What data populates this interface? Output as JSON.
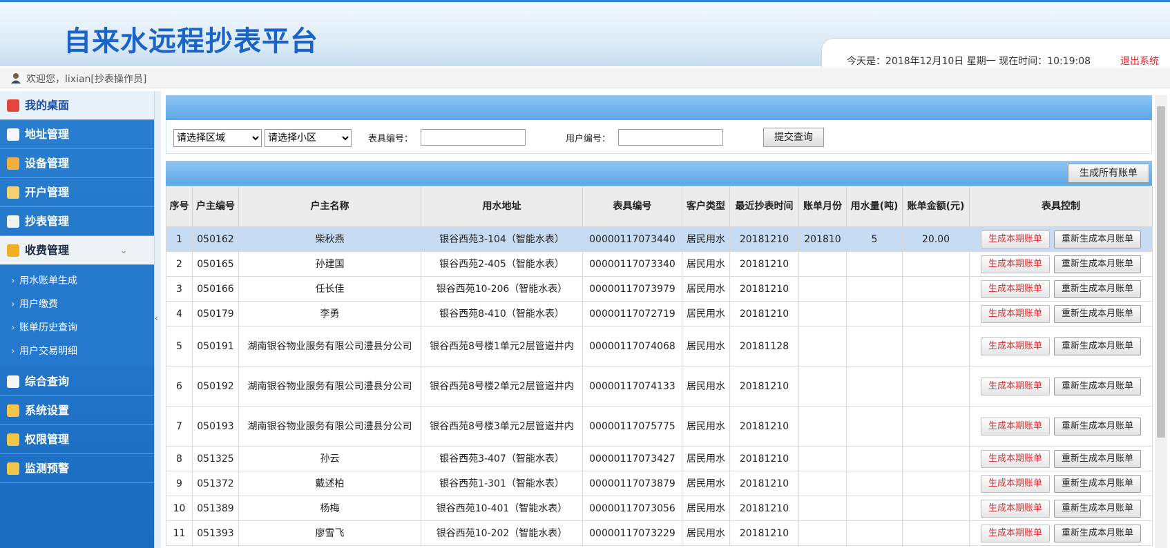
{
  "header": {
    "title": "自来水远程抄表平台",
    "date_text": "今天是：2018年12月10日 星期一 现在时间：10:19:08",
    "logout_label": "退出系统"
  },
  "welcome": "欢迎您，lixian[抄表操作员]",
  "sidebar": {
    "items": [
      {
        "label": "我的桌面",
        "icon": "home-icon"
      },
      {
        "label": "地址管理",
        "icon": "document-icon"
      },
      {
        "label": "设备管理",
        "icon": "device-icon"
      },
      {
        "label": "开户管理",
        "icon": "account-icon"
      },
      {
        "label": "抄表管理",
        "icon": "meter-read-icon"
      },
      {
        "label": "收费管理",
        "icon": "billing-icon"
      },
      {
        "label": "综合查询",
        "icon": "grid-icon"
      },
      {
        "label": "系统设置",
        "icon": "hourglass-icon"
      },
      {
        "label": "权限管理",
        "icon": "permission-icon"
      },
      {
        "label": "监测预警",
        "icon": "alert-icon"
      }
    ],
    "sub_items": [
      "用水账单生成",
      "用户缴费",
      "账单历史查询",
      "用户交易明细"
    ],
    "expand_icon": "chevron-down-icon"
  },
  "search": {
    "region_select": "请选择区域",
    "community_select": "请选择小区",
    "meter_no_label": "表具编号：",
    "meter_no_value": "",
    "user_no_label": "用户编号：",
    "user_no_value": "",
    "submit_label": "提交查询"
  },
  "generate_all_label": "生成所有账单",
  "table": {
    "headers": [
      "序号",
      "户主编号",
      "户主名称",
      "用水地址",
      "表具编号",
      "客户类型",
      "最近抄表时间",
      "账单月份",
      "用水量(吨)",
      "账单金额(元)",
      "表具控制"
    ],
    "btn_generate": "生成本期账单",
    "btn_regenerate": "重新生成本月账单",
    "rows": [
      {
        "no": "1",
        "owner_id": "050162",
        "name": "柴秋燕",
        "address": "银谷西苑3-104（智能水表）",
        "meter": "00000117073440",
        "type": "居民用水",
        "read_time": "20181210",
        "month": "201810",
        "usage": "5",
        "amount": "20.00"
      },
      {
        "no": "2",
        "owner_id": "050165",
        "name": "孙建国",
        "address": "银谷西苑2-405（智能水表）",
        "meter": "00000117073340",
        "type": "居民用水",
        "read_time": "20181210",
        "month": "",
        "usage": "",
        "amount": ""
      },
      {
        "no": "3",
        "owner_id": "050166",
        "name": "任长佳",
        "address": "银谷西苑10-206（智能水表）",
        "meter": "00000117073979",
        "type": "居民用水",
        "read_time": "20181210",
        "month": "",
        "usage": "",
        "amount": ""
      },
      {
        "no": "4",
        "owner_id": "050179",
        "name": "李勇",
        "address": "银谷西苑8-410（智能水表）",
        "meter": "00000117072719",
        "type": "居民用水",
        "read_time": "20181210",
        "month": "",
        "usage": "",
        "amount": ""
      },
      {
        "no": "5",
        "owner_id": "050191",
        "name": "湖南银谷物业服务有限公司澧县分公司",
        "address": "银谷西苑8号楼1单元2层管道井内",
        "meter": "00000117074068",
        "type": "居民用水",
        "read_time": "20181128",
        "month": "",
        "usage": "",
        "amount": ""
      },
      {
        "no": "6",
        "owner_id": "050192",
        "name": "湖南银谷物业服务有限公司澧县分公司",
        "address": "银谷西苑8号楼2单元2层管道井内",
        "meter": "00000117074133",
        "type": "居民用水",
        "read_time": "20181210",
        "month": "",
        "usage": "",
        "amount": ""
      },
      {
        "no": "7",
        "owner_id": "050193",
        "name": "湖南银谷物业服务有限公司澧县分公司",
        "address": "银谷西苑8号楼3单元2层管道井内",
        "meter": "00000117075775",
        "type": "居民用水",
        "read_time": "20181210",
        "month": "",
        "usage": "",
        "amount": ""
      },
      {
        "no": "8",
        "owner_id": "051325",
        "name": "孙云",
        "address": "银谷西苑3-407（智能水表）",
        "meter": "00000117073427",
        "type": "居民用水",
        "read_time": "20181210",
        "month": "",
        "usage": "",
        "amount": ""
      },
      {
        "no": "9",
        "owner_id": "051372",
        "name": "戴述柏",
        "address": "银谷西苑1-301（智能水表）",
        "meter": "00000117073879",
        "type": "居民用水",
        "read_time": "20181210",
        "month": "",
        "usage": "",
        "amount": ""
      },
      {
        "no": "10",
        "owner_id": "051389",
        "name": "杨梅",
        "address": "银谷西苑10-401（智能水表）",
        "meter": "00000117073056",
        "type": "居民用水",
        "read_time": "20181210",
        "month": "",
        "usage": "",
        "amount": ""
      },
      {
        "no": "11",
        "owner_id": "051393",
        "name": "廖雪飞",
        "address": "银谷西苑10-202（智能水表）",
        "meter": "00000117073229",
        "type": "居民用水",
        "read_time": "20181210",
        "month": "",
        "usage": "",
        "amount": ""
      }
    ]
  }
}
